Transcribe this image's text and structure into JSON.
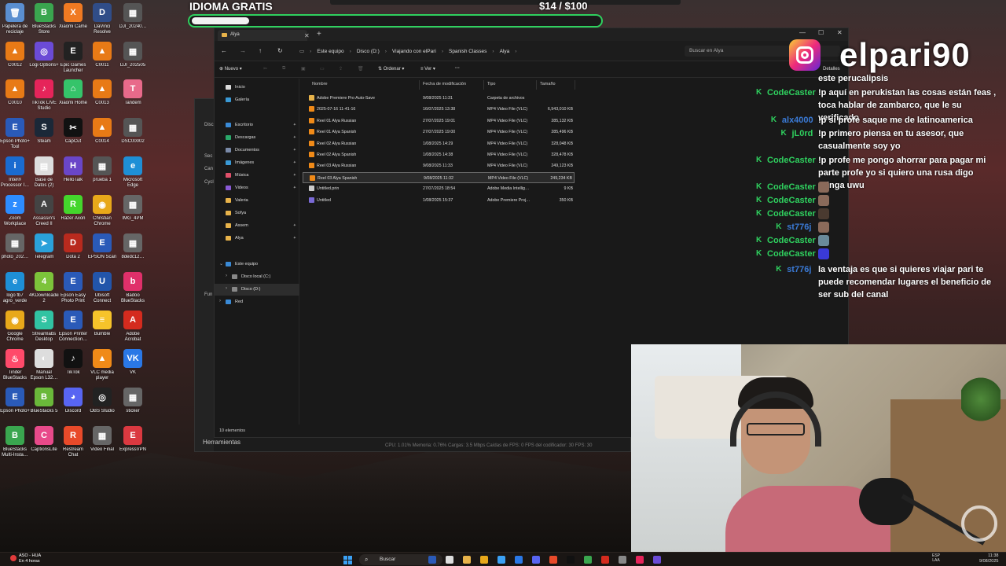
{
  "overlay": {
    "goal_title": "IDIOMA GRATIS",
    "goal_amount": "$14  / $100",
    "goal_progress": 0.14,
    "instagram_handle": "elpari90"
  },
  "desktop": {
    "icons": [
      {
        "label": "Papelera de reciclaje",
        "color": "#5a8fd0",
        "glyph": "🗑"
      },
      {
        "label": "BlueStacks Store",
        "color": "#3aa64f",
        "glyph": "B"
      },
      {
        "label": "Xiaomi Came",
        "color": "#f07a22",
        "glyph": "X"
      },
      {
        "label": "DaVinci Resolve",
        "color": "#304d88",
        "glyph": "D"
      },
      {
        "label": "DJI_20240…",
        "color": "#555555",
        "glyph": "▦"
      },
      {
        "label": "C0012",
        "color": "#e87a16",
        "glyph": "▲"
      },
      {
        "label": "Logi Options+",
        "color": "#6b4bd6",
        "glyph": "◎"
      },
      {
        "label": "Epic Games Launcher",
        "color": "#222222",
        "glyph": "E"
      },
      {
        "label": "C0011",
        "color": "#e87a16",
        "glyph": "▲"
      },
      {
        "label": "DJI_202505",
        "color": "#555555",
        "glyph": "▦"
      },
      {
        "label": "C0010",
        "color": "#e87a16",
        "glyph": "▲"
      },
      {
        "label": "TikTok LIVE Studio",
        "color": "#e6245a",
        "glyph": "♪"
      },
      {
        "label": "Xiaomi Home",
        "color": "#35c46a",
        "glyph": "⌂"
      },
      {
        "label": "C0013",
        "color": "#e87a16",
        "glyph": "▲"
      },
      {
        "label": "Tandem",
        "color": "#e86a8a",
        "glyph": "T"
      },
      {
        "label": "Epson Photo+ Tool",
        "color": "#2a5ab8",
        "glyph": "E"
      },
      {
        "label": "Steam",
        "color": "#1b2838",
        "glyph": "S"
      },
      {
        "label": "CapCut",
        "color": "#111111",
        "glyph": "✂"
      },
      {
        "label": "C0014",
        "color": "#e87a16",
        "glyph": "▲"
      },
      {
        "label": "DSC00002",
        "color": "#555555",
        "glyph": "▦"
      },
      {
        "label": "Intel® Processor I…",
        "color": "#1a6bd0",
        "glyph": "i"
      },
      {
        "label": "Base de Datos (2)",
        "color": "#dddddd",
        "glyph": "▤"
      },
      {
        "label": "HelloTalk",
        "color": "#6a46c8",
        "glyph": "H"
      },
      {
        "label": "prueba 1",
        "color": "#555555",
        "glyph": "▦"
      },
      {
        "label": "Microsoft Edge",
        "color": "#1e8fd6",
        "glyph": "e"
      },
      {
        "label": "Zoom Workplace",
        "color": "#2d8cff",
        "glyph": "z"
      },
      {
        "label": "Assassin's Creed II",
        "color": "#444444",
        "glyph": "A"
      },
      {
        "label": "Razer Axon",
        "color": "#44d62c",
        "glyph": "R"
      },
      {
        "label": "Christian Chrome",
        "color": "#e8a81a",
        "glyph": "◉"
      },
      {
        "label": "IMG_4PM",
        "color": "#666666",
        "glyph": "▦"
      },
      {
        "label": "photo_202…",
        "color": "#666666",
        "glyph": "▦"
      },
      {
        "label": "Telegram",
        "color": "#2aa1da",
        "glyph": "➤"
      },
      {
        "label": "Dota 2",
        "color": "#b82a1e",
        "glyph": "D"
      },
      {
        "label": "EPSON Scan",
        "color": "#2a5ab8",
        "glyph": "E"
      },
      {
        "label": "8dedc12…",
        "color": "#666666",
        "glyph": "▦"
      },
      {
        "label": "logo fb7 agro_verde",
        "color": "#1e8fd6",
        "glyph": "e"
      },
      {
        "label": "4KDownloader 2",
        "color": "#7cc33a",
        "glyph": "4"
      },
      {
        "label": "Epson Easy Photo Print",
        "color": "#2a5ab8",
        "glyph": "E"
      },
      {
        "label": "Ubisoft Connect",
        "color": "#2255aa",
        "glyph": "U"
      },
      {
        "label": "Badoo BlueStacks",
        "color": "#e0306a",
        "glyph": "b"
      },
      {
        "label": "Google Chrome",
        "color": "#e8a81a",
        "glyph": "◉"
      },
      {
        "label": "Streamlabs Desktop",
        "color": "#31c3a2",
        "glyph": "S"
      },
      {
        "label": "Epson Printer Connection…",
        "color": "#2a5ab8",
        "glyph": "E"
      },
      {
        "label": "Bumble",
        "color": "#f6c32a",
        "glyph": "≡"
      },
      {
        "label": "Adobe Acrobat",
        "color": "#d42b1e",
        "glyph": "A"
      },
      {
        "label": "Tinder BlueStacks",
        "color": "#ff4a6a",
        "glyph": "♨"
      },
      {
        "label": "Manual Epson L32…",
        "color": "#dddddd",
        "glyph": "◐"
      },
      {
        "label": "TikTok",
        "color": "#111111",
        "glyph": "♪"
      },
      {
        "label": "VLC media player",
        "color": "#f08a18",
        "glyph": "▲"
      },
      {
        "label": "VK",
        "color": "#2a78e6",
        "glyph": "VK"
      },
      {
        "label": "Epson Photo+",
        "color": "#2a5ab8",
        "glyph": "E"
      },
      {
        "label": "BlueStacks 5",
        "color": "#6ab83a",
        "glyph": "B"
      },
      {
        "label": "Discord",
        "color": "#5865f2",
        "glyph": "◕"
      },
      {
        "label": "OBS Studio",
        "color": "#222222",
        "glyph": "◎"
      },
      {
        "label": "sticker",
        "color": "#666666",
        "glyph": "▦"
      },
      {
        "label": "BlueStacks Multi-Insta…",
        "color": "#3aa64f",
        "glyph": "B"
      },
      {
        "label": "CaptionsLite",
        "color": "#e84a8a",
        "glyph": "C"
      },
      {
        "label": "Restream Chat",
        "color": "#e84a2a",
        "glyph": "R"
      },
      {
        "label": "Video Final",
        "color": "#666666",
        "glyph": "▦"
      },
      {
        "label": "ExpressVPN",
        "color": "#da3940",
        "glyph": "E"
      }
    ]
  },
  "obs": {
    "letters": [
      "Disc",
      "Sec",
      "Can",
      "Cycl",
      "Fun"
    ],
    "bottom_label": "Herramientas",
    "stats": "CPU: 1.01%    Memoria: 0.76%    Cargas: 3.5 Mbps    Caídas de FPS: 0    FPS del codificador: 30    FPS: 30"
  },
  "explorer": {
    "tab_title": "Alya",
    "breadcrumb": [
      "Este equipo",
      "Disco (D:)",
      "Viajando con elPari",
      "Spanish Classes",
      "Alya"
    ],
    "search_placeholder": "Buscar en Alya",
    "toolbar": {
      "new": "Nuevo",
      "sort": "Ordenar",
      "view": "Ver",
      "more": "···",
      "details": "Detalles"
    },
    "nav": {
      "home": "Inicio",
      "gallery": "Galería",
      "quick": [
        {
          "label": "Escritorio",
          "color": "#3a8ad6"
        },
        {
          "label": "Descargas",
          "color": "#2aa86a"
        },
        {
          "label": "Documentos",
          "color": "#7a8aa8"
        },
        {
          "label": "Imágenes",
          "color": "#3a9ad6"
        },
        {
          "label": "Música",
          "color": "#e0506a"
        },
        {
          "label": "Videos",
          "color": "#8a5ad6"
        },
        {
          "label": "Valeria",
          "color": "#e8b34a"
        },
        {
          "label": "Sofya",
          "color": "#e8b34a"
        },
        {
          "label": "Assem",
          "color": "#e8b34a"
        },
        {
          "label": "Alya",
          "color": "#e8b34a"
        }
      ],
      "this_pc": "Este equipo",
      "drive_c": "Disco local (C:)",
      "drive_d": "Disco (D:)",
      "network": "Red"
    },
    "columns": {
      "name": "Nombre",
      "date": "Fecha de modificación",
      "type": "Tipo",
      "size": "Tamaño"
    },
    "files": [
      {
        "name": "Adobe Premiere Pro Auto-Save",
        "date": "9/08/2025 11:31",
        "type": "Carpeta de archivos",
        "size": "",
        "icon": "#e8b34a",
        "selected": false
      },
      {
        "name": "2025-07-16 11-41-16",
        "date": "16/07/2025 13:38",
        "type": "MP4 Video File (VLC)",
        "size": "6,943,010 KB",
        "icon": "#f08a18",
        "selected": false
      },
      {
        "name": "Reel 01 Alya Russian",
        "date": "27/07/2025 19:01",
        "type": "MP4 Video File (VLC)",
        "size": "285,132 KB",
        "icon": "#f08a18",
        "selected": false
      },
      {
        "name": "Reel 01 Alya Spanish",
        "date": "27/07/2025 19:00",
        "type": "MP4 Video File (VLC)",
        "size": "285,496 KB",
        "icon": "#f08a18",
        "selected": false
      },
      {
        "name": "Reel 02 Alya Russian",
        "date": "1/08/2025 14:29",
        "type": "MP4 Video File (VLC)",
        "size": "328,048 KB",
        "icon": "#f08a18",
        "selected": false
      },
      {
        "name": "Reel 02 Alya Spanish",
        "date": "1/08/2025 14:38",
        "type": "MP4 Video File (VLC)",
        "size": "328,478 KB",
        "icon": "#f08a18",
        "selected": false
      },
      {
        "name": "Reel 03 Alya Russian",
        "date": "9/08/2025 11:33",
        "type": "MP4 Video File (VLC)",
        "size": "249,123 KB",
        "icon": "#f08a18",
        "selected": false
      },
      {
        "name": "Reel 03 Alya Spanish",
        "date": "9/08/2025 11:32",
        "type": "MP4 Video File (VLC)",
        "size": "249,234 KB",
        "icon": "#f08a18",
        "selected": true
      },
      {
        "name": "Untitled.prin",
        "date": "27/07/2025 18:54",
        "type": "Adobe Media Intellig…",
        "size": "9 KB",
        "icon": "#cccccc",
        "selected": false
      },
      {
        "name": "Untitled",
        "date": "1/08/2025 15:37",
        "type": "Adobe Premiere Proj…",
        "size": "350 KB",
        "icon": "#7a6ad6",
        "selected": false
      }
    ],
    "status": "10 elementos"
  },
  "chat": {
    "messages": [
      {
        "user": "",
        "user_color": "#2fd15f",
        "text": "este perucalipsis",
        "badge": false,
        "emotes": []
      },
      {
        "user": "CodeCaster",
        "user_color": "#2fd15f",
        "text": "!p aquí en perukistan las cosas están feas , toca hablar de zambarco, que le su verificado",
        "badge": true,
        "emotes": []
      },
      {
        "user": "alx4000",
        "user_color": "#3a7ad6",
        "text": "!p si profe saque me de latinoamerica",
        "badge": true,
        "emotes": []
      },
      {
        "user": "jL0rd",
        "user_color": "#2fd15f",
        "text": "!p primero piensa en tu asesor, que casualmente soy yo",
        "badge": true,
        "emotes": []
      },
      {
        "user": "CodeCaster",
        "user_color": "#2fd15f",
        "text": "!p profe me pongo ahorrar para pagar mi parte profe yo si quiero una rusa digo gringa uwu",
        "badge": true,
        "emotes": []
      },
      {
        "user": "CodeCaster",
        "user_color": "#2fd15f",
        "text": "",
        "badge": true,
        "emotes": [
          "#8a6a5a"
        ]
      },
      {
        "user": "CodeCaster",
        "user_color": "#2fd15f",
        "text": "",
        "badge": true,
        "emotes": [
          "#8a6a5a"
        ]
      },
      {
        "user": "CodeCaster",
        "user_color": "#2fd15f",
        "text": "",
        "badge": true,
        "emotes": [
          "#4a3a30"
        ]
      },
      {
        "user": "st776j",
        "user_color": "#3a7ad6",
        "text": "",
        "badge": true,
        "emotes": [
          "#8a6a5a"
        ]
      },
      {
        "user": "CodeCaster",
        "user_color": "#2fd15f",
        "text": "",
        "badge": true,
        "emotes": [
          "#6a8a9a"
        ]
      },
      {
        "user": "CodeCaster",
        "user_color": "#2fd15f",
        "text": "",
        "badge": true,
        "emotes": [
          "#3a3ad6"
        ]
      },
      {
        "user": "st776j",
        "user_color": "#3a7ad6",
        "text": "la ventaja es que si quieres viajar pari te puede recomendar lugares el beneficio de ser sub del canal",
        "badge": true,
        "emotes": []
      }
    ]
  },
  "taskbar": {
    "weather_temp": "ASO - HUA",
    "weather_sub": "En 4 horas",
    "search_label": "Buscar",
    "lang_line1": "ESP",
    "lang_line2": "LAA",
    "time": "11:38",
    "date": "9/08/2025",
    "apps": [
      "#2a5ab8",
      "#dddddd",
      "#e8b34a",
      "#e8a81a",
      "#3ba1f5",
      "#2a78e6",
      "#5865f2",
      "#e84a2a",
      "#111111",
      "#3aa64f",
      "#d42b1e",
      "#888888",
      "#e6245a",
      "#6b4bd6"
    ]
  }
}
